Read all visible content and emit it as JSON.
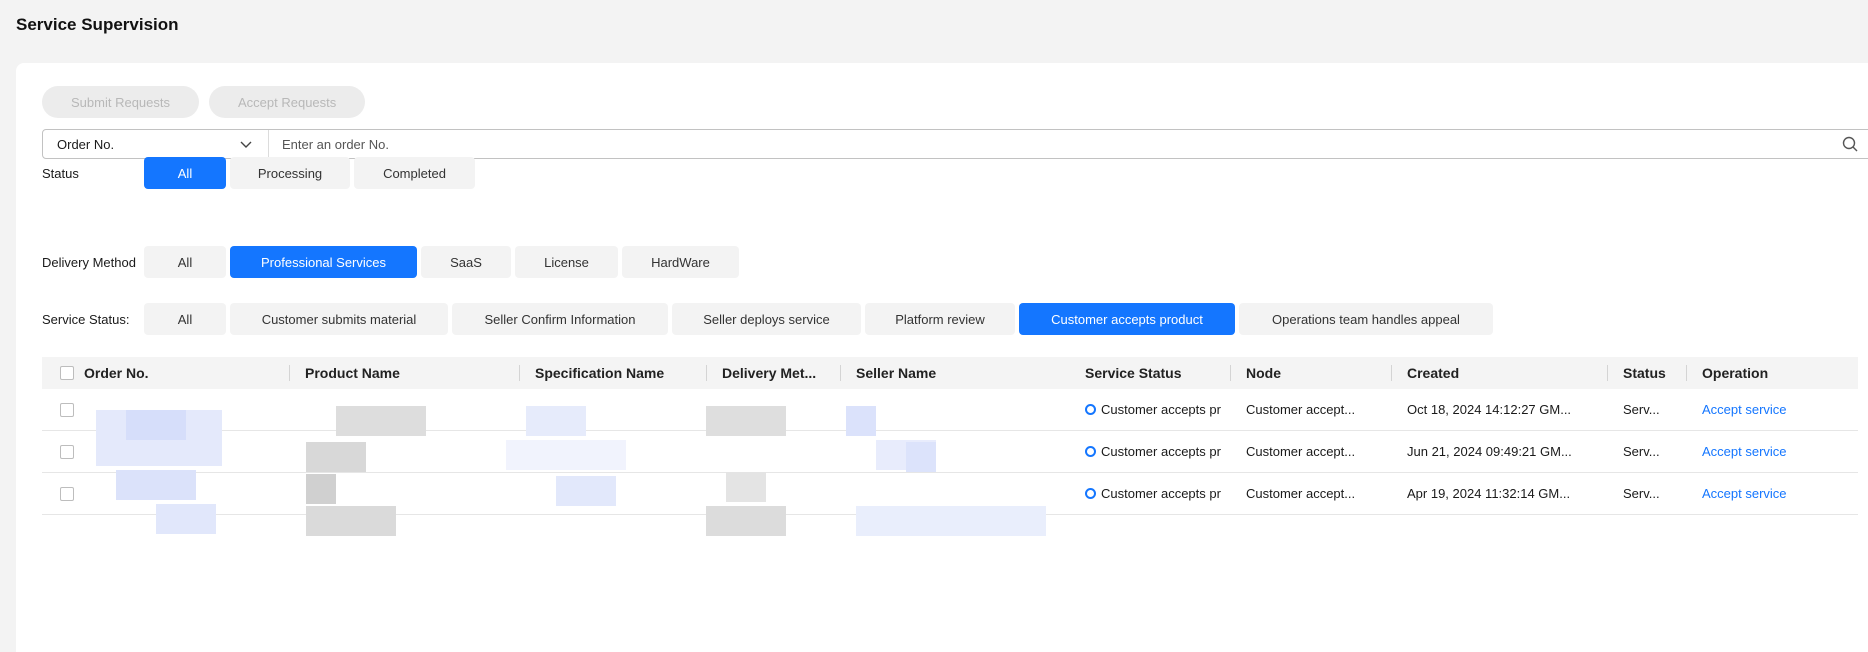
{
  "page": {
    "title": "Service Supervision"
  },
  "actions": {
    "submit_requests": "Submit Requests",
    "accept_requests": "Accept Requests"
  },
  "search": {
    "field_select": "Order No.",
    "placeholder": "Enter an order No."
  },
  "filters": {
    "status": {
      "label": "Status",
      "options": [
        "All",
        "Processing",
        "Completed"
      ],
      "selected": "All"
    },
    "delivery_method": {
      "label": "Delivery Method",
      "options": [
        "All",
        "Professional Services",
        "SaaS",
        "License",
        "HardWare"
      ],
      "selected": "Professional Services"
    },
    "service_status": {
      "label": "Service Status:",
      "options": [
        "All",
        "Customer submits material",
        "Seller Confirm Information",
        "Seller deploys service",
        "Platform review",
        "Customer accepts product",
        "Operations team handles appeal"
      ],
      "selected": "Customer accepts product"
    }
  },
  "table": {
    "columns": [
      "Order No.",
      "Product Name",
      "Specification Name",
      "Delivery Met...",
      "Seller Name",
      "Service Status",
      "Node",
      "Created",
      "Status",
      "Operation"
    ],
    "rows": [
      {
        "service_status": "Customer accepts pr",
        "node": "Customer accept...",
        "created": "Oct 18, 2024 14:12:27 GM...",
        "status": "Serv...",
        "operation": "Accept service"
      },
      {
        "service_status": "Customer accepts pr",
        "node": "Customer accept...",
        "created": "Jun 21, 2024 09:49:21 GM...",
        "status": "Serv...",
        "operation": "Accept service"
      },
      {
        "service_status": "Customer accepts pr",
        "node": "Customer accept...",
        "created": "Apr 19, 2024 11:32:14 GM...",
        "status": "Serv...",
        "operation": "Accept service"
      }
    ]
  },
  "colors": {
    "accent": "#1476ff",
    "background": "#f3f3f3",
    "card": "#ffffff"
  }
}
